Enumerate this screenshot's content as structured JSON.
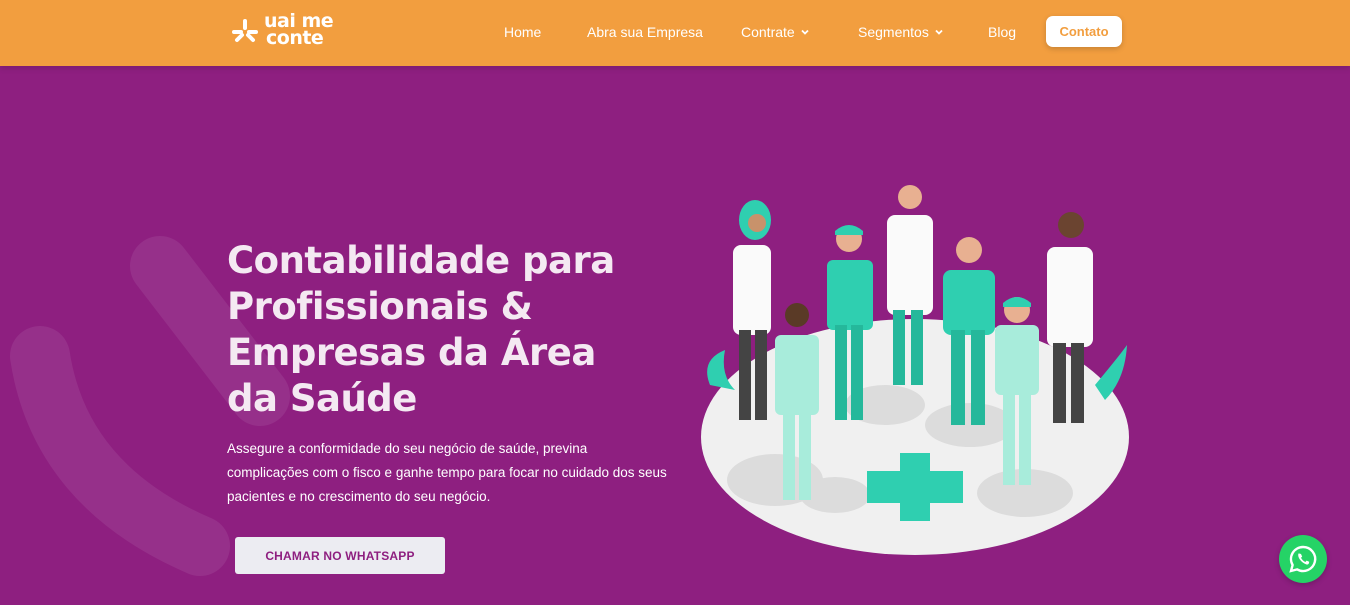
{
  "brand": {
    "logo_line1": "uai me",
    "logo_line2": "conte",
    "logo_icon": "asterisk-logo-icon"
  },
  "nav": {
    "items": [
      {
        "label": "Home"
      },
      {
        "label": "Abra sua Empresa"
      },
      {
        "label": "Contrate",
        "dropdown": true
      },
      {
        "label": "Segmentos",
        "dropdown": true
      },
      {
        "label": "Blog"
      }
    ],
    "contact_label": "Contato"
  },
  "hero": {
    "title": "Contabilidade para Profissionais & Empresas da Área da Saúde",
    "description": "Assegure a conformidade do seu negócio de saúde, previna complicações com o fisco e ganhe tempo para focar no cuidado dos seus pacientes e no crescimento do seu negócio.",
    "cta_label": "CHAMAR NO WHATSAPP",
    "illustration": "healthcare-team-illustration"
  },
  "floating": {
    "whatsapp_icon": "whatsapp-icon"
  },
  "colors": {
    "header": "#f29e3f",
    "hero_bg": "#8e1f80",
    "whatsapp": "#25d366",
    "accent_green": "#2fcfb0"
  }
}
